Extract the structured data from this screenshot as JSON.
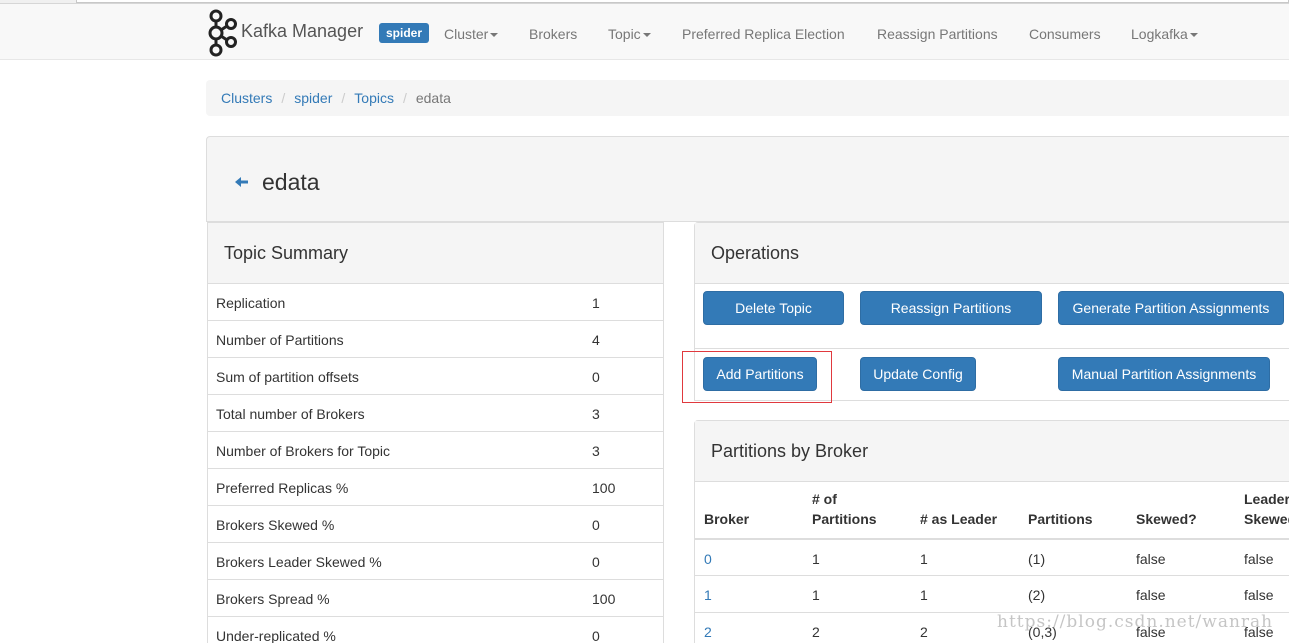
{
  "navbar": {
    "brand": "Kafka Manager",
    "cluster_badge": "spider",
    "items": [
      {
        "label": "Cluster",
        "dropdown": true
      },
      {
        "label": "Brokers",
        "dropdown": false
      },
      {
        "label": "Topic",
        "dropdown": true
      },
      {
        "label": "Preferred Replica Election",
        "dropdown": false
      },
      {
        "label": "Reassign Partitions",
        "dropdown": false
      },
      {
        "label": "Consumers",
        "dropdown": false
      },
      {
        "label": "Logkafka",
        "dropdown": true
      }
    ]
  },
  "breadcrumb": {
    "items": [
      "Clusters",
      "spider",
      "Topics"
    ],
    "active": "edata",
    "separator": "/"
  },
  "page": {
    "title": "edata",
    "back_icon": "arrow-left-icon"
  },
  "topic_summary": {
    "title": "Topic Summary",
    "rows": [
      {
        "label": "Replication",
        "value": "1"
      },
      {
        "label": "Number of Partitions",
        "value": "4"
      },
      {
        "label": "Sum of partition offsets",
        "value": "0"
      },
      {
        "label": "Total number of Brokers",
        "value": "3"
      },
      {
        "label": "Number of Brokers for Topic",
        "value": "3"
      },
      {
        "label": "Preferred Replicas %",
        "value": "100"
      },
      {
        "label": "Brokers Skewed %",
        "value": "0"
      },
      {
        "label": "Brokers Leader Skewed %",
        "value": "0"
      },
      {
        "label": "Brokers Spread %",
        "value": "100"
      },
      {
        "label": "Under-replicated %",
        "value": "0"
      }
    ]
  },
  "operations": {
    "title": "Operations",
    "buttons": {
      "delete_topic": "Delete Topic",
      "reassign_partitions": "Reassign Partitions",
      "generate_assignments": "Generate Partition Assignments",
      "add_partitions": "Add Partitions",
      "update_config": "Update Config",
      "manual_assignments": "Manual Partition Assignments"
    }
  },
  "partitions_by_broker": {
    "title": "Partitions by Broker",
    "headers": {
      "broker": "Broker",
      "num_partitions_1": "# of",
      "num_partitions_2": "Partitions",
      "as_leader": "# as Leader",
      "partitions": "Partitions",
      "skewed": "Skewed?",
      "leader_skewed_1": "Leader",
      "leader_skewed_2": "Skewed?"
    },
    "rows": [
      {
        "broker": "0",
        "num_partitions": "1",
        "as_leader": "1",
        "partitions": "(1)",
        "skewed": "false",
        "leader_skewed": "false"
      },
      {
        "broker": "1",
        "num_partitions": "1",
        "as_leader": "1",
        "partitions": "(2)",
        "skewed": "false",
        "leader_skewed": "false"
      },
      {
        "broker": "2",
        "num_partitions": "2",
        "as_leader": "2",
        "partitions": "(0,3)",
        "skewed": "false",
        "leader_skewed": "false"
      }
    ]
  },
  "watermark": "https://blog.csdn.net/wanrah",
  "colors": {
    "primary": "#337ab7",
    "highlight": "#e0393e"
  }
}
